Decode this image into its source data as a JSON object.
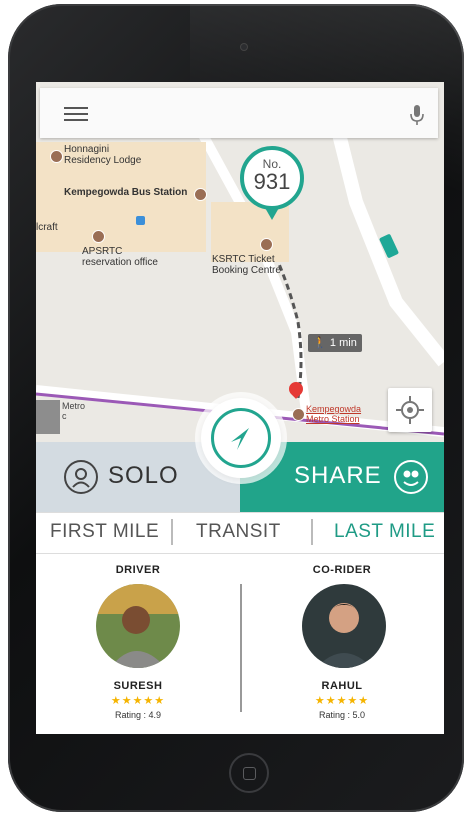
{
  "map": {
    "places": {
      "lodge": "Honnagini\nResidency Lodge",
      "bus_station": "Kempegowda Bus Station",
      "craft": "lcraft",
      "apsrtc": "APSRTC\nreservation office",
      "ksrtc": "KSRTC Ticket\nBooking Centre",
      "metro_left": "Metro\nc",
      "metro_station": "Kempegowda\nMetro Station"
    },
    "bus_bubble": {
      "prefix": "No.",
      "number": "931"
    },
    "walk_time": "1 min",
    "route_color": "#9b59b6"
  },
  "mode_toggle": {
    "solo_label": "SOLO",
    "share_label": "SHARE",
    "active": "SHARE",
    "solo_bg": "#d3dbe1",
    "share_bg": "#21a48a"
  },
  "tabs": [
    {
      "label": "FIRST MILE",
      "active": false
    },
    {
      "label": "TRANSIT",
      "active": false
    },
    {
      "label": "LAST MILE",
      "active": true
    }
  ],
  "driver": {
    "title": "DRIVER",
    "name": "SURESH",
    "stars": "★★★★★",
    "rating": "Rating : 4.9"
  },
  "corider": {
    "title": "CO-RIDER",
    "name": "RAHUL",
    "stars": "★★★★★",
    "rating": "Rating : 5.0"
  },
  "colors": {
    "accent": "#21a48a",
    "star": "#f5b400"
  }
}
